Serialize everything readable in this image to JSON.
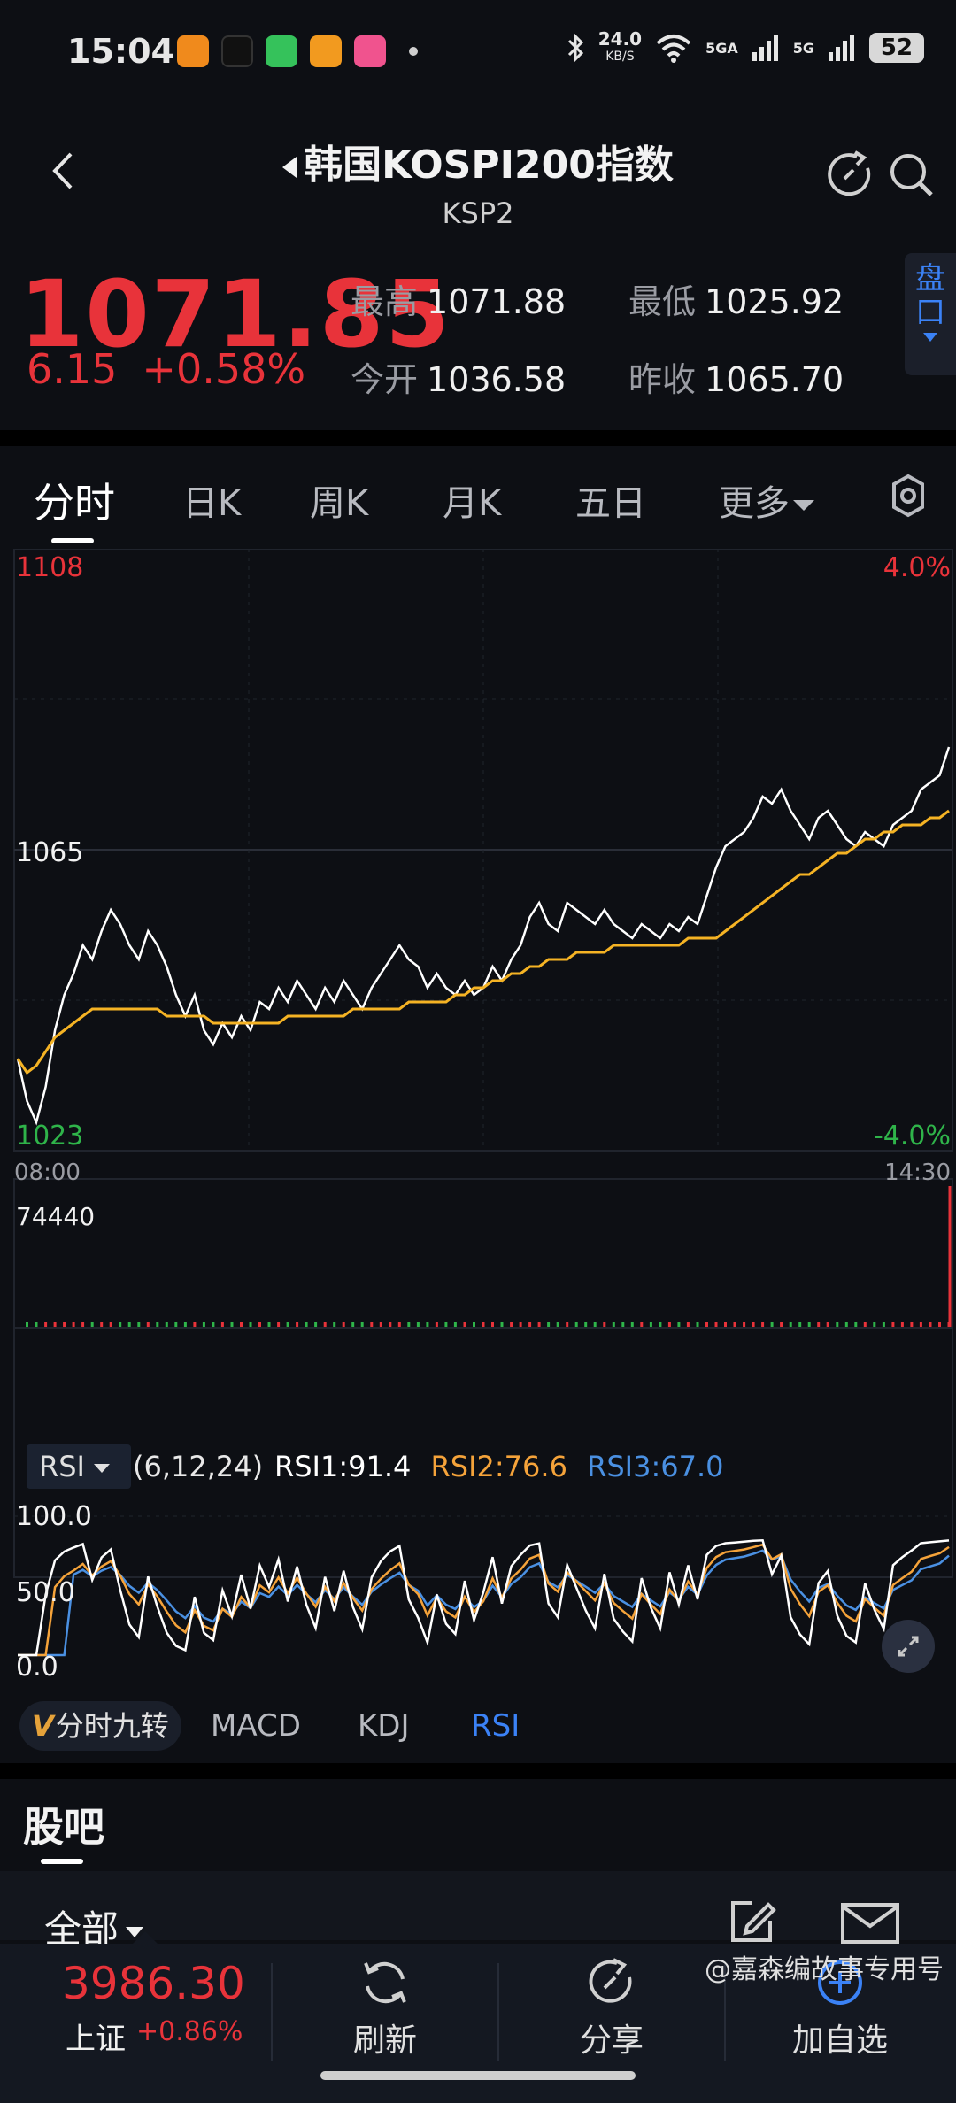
{
  "status": {
    "time": "15:04",
    "speed_value": "24.0",
    "speed_unit": "KB/S",
    "net1": "5GA",
    "net2": "5G",
    "battery": "52"
  },
  "header": {
    "title": "韩国KOSPI200指数",
    "subtitle": "KSP2"
  },
  "quote": {
    "price": "1071.85",
    "change_abs": "6.15",
    "change_pct": "+0.58%",
    "high_label": "最高",
    "high_value": "1071.88",
    "low_label": "最低",
    "low_value": "1025.92",
    "open_label": "今开",
    "open_value": "1036.58",
    "prev_close_label": "昨收",
    "prev_close_value": "1065.70",
    "pankou_label": "盘口"
  },
  "tabs": {
    "t1": "分时",
    "t2": "日K",
    "t3": "周K",
    "t4": "月K",
    "t5": "五日",
    "t6": "更多"
  },
  "chart_data": {
    "type": "line",
    "x_start": "08:00",
    "x_end": "14:30",
    "y_max_label": "1108",
    "y_mid_label": "1065",
    "y_min_label": "1023",
    "pct_max_label": "4.0%",
    "pct_min_label": "-4.0%",
    "ylim": [
      1023,
      1108
    ],
    "series": [
      {
        "values": [
          1036,
          1030,
          1027,
          1032,
          1040,
          1045,
          1048,
          1052,
          1050,
          1054,
          1057,
          1055,
          1052,
          1050,
          1054,
          1052,
          1049,
          1045,
          1042,
          1045,
          1040,
          1038,
          1041,
          1039,
          1042,
          1040,
          1044,
          1043,
          1046,
          1044,
          1047,
          1045,
          1043,
          1046,
          1044,
          1047,
          1045,
          1043,
          1046,
          1048,
          1050,
          1052,
          1050,
          1049,
          1046,
          1048,
          1046,
          1045,
          1047,
          1045,
          1046,
          1049,
          1047,
          1050,
          1052,
          1056,
          1058,
          1055,
          1054,
          1058,
          1057,
          1056,
          1055,
          1057,
          1055,
          1054,
          1053,
          1055,
          1054,
          1053,
          1055,
          1054,
          1056,
          1055,
          1059,
          1063,
          1066,
          1067,
          1068,
          1070,
          1073,
          1072,
          1074,
          1071,
          1069,
          1067,
          1070,
          1071,
          1069,
          1067,
          1066,
          1068,
          1067,
          1066,
          1069,
          1070,
          1071,
          1074,
          1075,
          1076,
          1080
        ],
        "color": "#ffffff"
      },
      {
        "values": [
          1036,
          1034,
          1035,
          1037,
          1039,
          1040,
          1041,
          1042,
          1043,
          1043,
          1043,
          1043,
          1043,
          1043,
          1043,
          1043,
          1042,
          1042,
          1042,
          1042,
          1042,
          1041,
          1041,
          1041,
          1041,
          1041,
          1041,
          1041,
          1041,
          1042,
          1042,
          1042,
          1042,
          1042,
          1042,
          1042,
          1043,
          1043,
          1043,
          1043,
          1043,
          1043,
          1044,
          1044,
          1044,
          1044,
          1044,
          1045,
          1045,
          1046,
          1046,
          1047,
          1047,
          1048,
          1048,
          1049,
          1049,
          1050,
          1050,
          1050,
          1051,
          1051,
          1051,
          1051,
          1052,
          1052,
          1052,
          1052,
          1052,
          1052,
          1052,
          1052,
          1053,
          1053,
          1053,
          1053,
          1054,
          1055,
          1056,
          1057,
          1058,
          1059,
          1060,
          1061,
          1062,
          1062,
          1063,
          1064,
          1065,
          1065,
          1066,
          1067,
          1067,
          1068,
          1068,
          1069,
          1069,
          1069,
          1070,
          1070,
          1071
        ],
        "color": "#f5b324"
      }
    ],
    "volume_label": "74440",
    "rsi": {
      "selector": "RSI",
      "params": "(6,12,24)",
      "rsi1_label": "RSI1:91.4",
      "rsi2_label": "RSI2:76.6",
      "rsi3_label": "RSI3:67.0",
      "rsi1_color": "#ffffff",
      "rsi2_color": "#f5a33a",
      "rsi3_color": "#4a90e2",
      "y_labels": [
        "100.0",
        "50.0",
        "0.0"
      ],
      "ylim": [
        0,
        100
      ]
    }
  },
  "indicators": {
    "jiuzhuan_v": "V",
    "jiuzhuan": "分时九转",
    "macd": "MACD",
    "kdj": "KDJ",
    "rsi": "RSI"
  },
  "forum": {
    "title": "股吧",
    "filter": "全部"
  },
  "bottom": {
    "index_value": "3986.30",
    "index_name": "上证",
    "index_change": "+0.86%",
    "refresh": "刷新",
    "share": "分享",
    "add_watch": "加自选",
    "watermark": "@嘉森编故事专用号"
  },
  "colors": {
    "up": "#e8333a",
    "down": "#2fb44a",
    "accent": "#3b82f6"
  }
}
